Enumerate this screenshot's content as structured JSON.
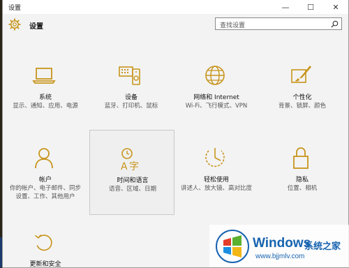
{
  "window": {
    "title": "设置",
    "minimize": "—",
    "maximize": "☐",
    "close": "✕"
  },
  "header": {
    "title": "设置",
    "search_placeholder": "查找设置"
  },
  "accent": "#c8951c",
  "categories": [
    {
      "name": "系统",
      "desc": "显示、通知、应用、电源",
      "icon": "laptop-icon"
    },
    {
      "name": "设备",
      "desc": "蓝牙、打印机、鼠标",
      "icon": "devices-icon"
    },
    {
      "name": "网络和 Internet",
      "desc": "Wi-Fi、飞行模式、VPN",
      "icon": "globe-icon"
    },
    {
      "name": "个性化",
      "desc": "背景、锁屏、颜色",
      "icon": "paintbrush-icon"
    },
    {
      "name": "帐户",
      "desc": "你的帐户、电子邮件、同步设置、工作、其他用户",
      "icon": "person-icon"
    },
    {
      "name": "时间和语言",
      "desc": "语音、区域、日期",
      "icon": "time-language-icon"
    },
    {
      "name": "轻松使用",
      "desc": "讲述人、放大镜、高对比度",
      "icon": "ease-of-access-icon"
    },
    {
      "name": "隐私",
      "desc": "位置、相机",
      "icon": "lock-icon"
    },
    {
      "name": "更新和安全",
      "desc": "",
      "icon": "update-icon"
    }
  ],
  "watermark": {
    "brand": "Windows",
    "brand2": "系统之家",
    "url": "www.bjjmlv.com"
  }
}
